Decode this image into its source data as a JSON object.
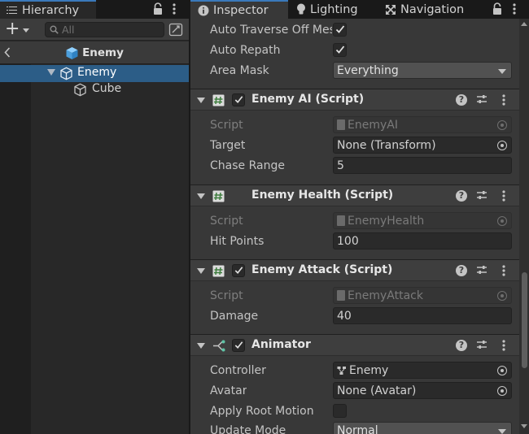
{
  "hierarchy": {
    "tab_label": "Hierarchy",
    "add_symbol": "+",
    "search_placeholder": "All",
    "scene_title": "Enemy",
    "rows": [
      {
        "label": "Enemy",
        "selected": true,
        "expanded": true
      },
      {
        "label": "Cube",
        "selected": false
      }
    ]
  },
  "inspector": {
    "tabs": [
      {
        "label": "Inspector",
        "icon": "info-icon",
        "active": true
      },
      {
        "label": "Lighting",
        "icon": "lightbulb-icon",
        "active": false
      },
      {
        "label": "Navigation",
        "icon": "navigation-icon",
        "active": false
      }
    ],
    "nav_agent": {
      "auto_traverse_label": "Auto Traverse Off Mesh Link",
      "auto_traverse_checked": true,
      "auto_repath_label": "Auto Repath",
      "auto_repath_checked": true,
      "area_mask_label": "Area Mask",
      "area_mask_value": "Everything"
    },
    "components": {
      "enemy_ai": {
        "title": "Enemy AI (Script)",
        "enabled": true,
        "script_label": "Script",
        "script_value": "EnemyAI",
        "target_label": "Target",
        "target_value": "None (Transform)",
        "chase_range_label": "Chase Range",
        "chase_range_value": "5"
      },
      "enemy_health": {
        "title": "Enemy Health (Script)",
        "script_label": "Script",
        "script_value": "EnemyHealth",
        "hit_points_label": "Hit Points",
        "hit_points_value": "100"
      },
      "enemy_attack": {
        "title": "Enemy Attack (Script)",
        "enabled": true,
        "script_label": "Script",
        "script_value": "EnemyAttack",
        "damage_label": "Damage",
        "damage_value": "40"
      },
      "animator": {
        "title": "Animator",
        "enabled": true,
        "controller_label": "Controller",
        "controller_value": "Enemy",
        "avatar_label": "Avatar",
        "avatar_value": "None (Avatar)",
        "apply_root_motion_label": "Apply Root Motion",
        "apply_root_motion_checked": false,
        "update_mode_label": "Update Mode",
        "update_mode_value": "Normal"
      }
    },
    "help_symbol": "?"
  },
  "colors": {
    "selection": "#2c5d87",
    "active_tab_line": "#3a79bb",
    "script_icon_green": "#6fb56f",
    "prefab_blue": "#68b2e8",
    "panel_bg": "#383838"
  }
}
